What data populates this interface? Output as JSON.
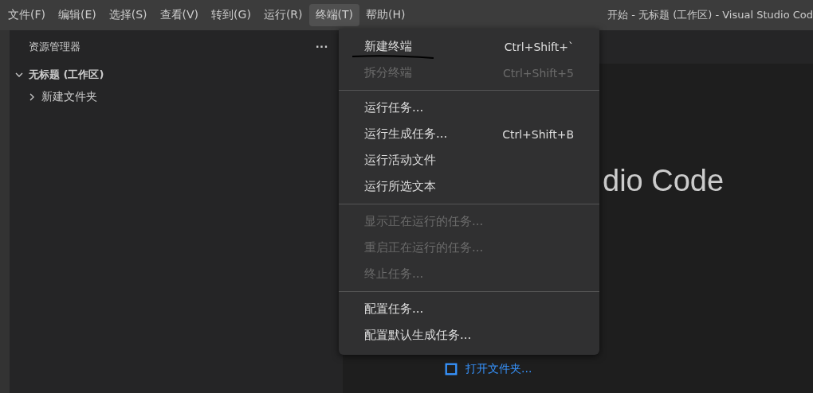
{
  "menubar": {
    "items": [
      {
        "label": "文件(F)",
        "selected": false
      },
      {
        "label": "编辑(E)",
        "selected": false
      },
      {
        "label": "选择(S)",
        "selected": false
      },
      {
        "label": "查看(V)",
        "selected": false
      },
      {
        "label": "转到(G)",
        "selected": false
      },
      {
        "label": "运行(R)",
        "selected": false
      },
      {
        "label": "终端(T)",
        "selected": true
      },
      {
        "label": "帮助(H)",
        "selected": false
      }
    ]
  },
  "window": {
    "title": "开始 - 无标题 (工作区) - Visual Studio Cod"
  },
  "sidebar": {
    "title": "资源管理器",
    "more": "···",
    "tree": [
      {
        "label": "无标题 (工作区)",
        "expanded": true,
        "children": [
          {
            "label": "新建文件夹",
            "expanded": false
          }
        ]
      }
    ]
  },
  "editor": {
    "heading": "dio Code",
    "link": "打开文件夹..."
  },
  "menu": {
    "groups": [
      [
        {
          "label": "新建终端",
          "shortcut": "Ctrl+Shift+`",
          "disabled": false,
          "marked": true
        },
        {
          "label": "拆分终端",
          "shortcut": "Ctrl+Shift+5",
          "disabled": true,
          "marked": false
        }
      ],
      [
        {
          "label": "运行任务...",
          "disabled": false,
          "marked": false
        },
        {
          "label": "运行生成任务...",
          "shortcut": "Ctrl+Shift+B",
          "disabled": false,
          "marked": false
        },
        {
          "label": "运行活动文件",
          "disabled": false,
          "marked": false
        },
        {
          "label": "运行所选文本",
          "disabled": false,
          "marked": false
        }
      ],
      [
        {
          "label": "显示正在运行的任务...",
          "disabled": true,
          "marked": false
        },
        {
          "label": "重启正在运行的任务...",
          "disabled": true,
          "marked": false
        },
        {
          "label": "终止任务...",
          "disabled": true,
          "marked": false
        }
      ],
      [
        {
          "label": "配置任务...",
          "disabled": false,
          "marked": false
        },
        {
          "label": "配置默认生成任务...",
          "disabled": false,
          "marked": false
        }
      ]
    ]
  }
}
